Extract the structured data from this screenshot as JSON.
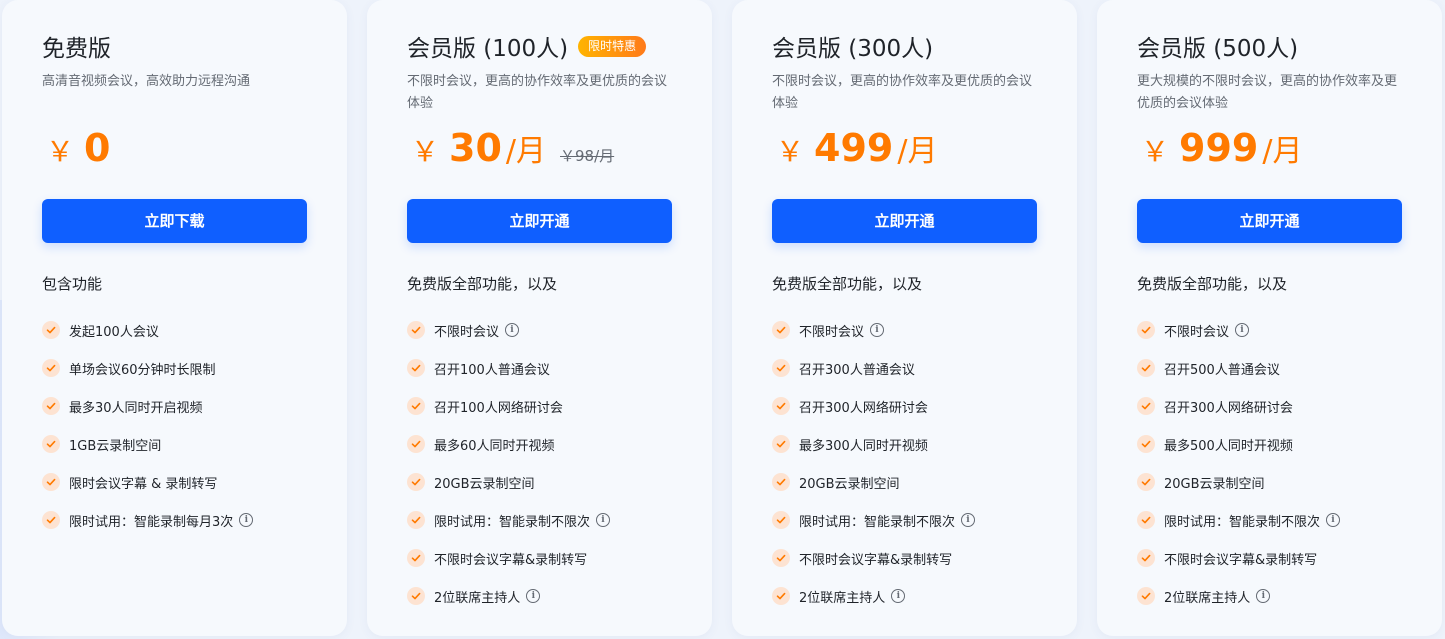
{
  "plans": [
    {
      "title": "免费版",
      "badge": "",
      "description": "高清音视频会议，高效助力远程沟通",
      "currency": "￥",
      "amount": "0",
      "unit": "",
      "original_price": "",
      "cta": "立即下载",
      "features_heading": "包含功能",
      "features": [
        {
          "text": "发起100人会议",
          "info": false
        },
        {
          "text": "单场会议60分钟时长限制",
          "info": false
        },
        {
          "text": "最多30人同时开启视频",
          "info": false
        },
        {
          "text": "1GB云录制空间",
          "info": false
        },
        {
          "text": "限时会议字幕 & 录制转写",
          "info": false
        },
        {
          "text": "限时试用：智能录制每月3次",
          "info": true
        }
      ]
    },
    {
      "title": "会员版 (100人)",
      "badge": "限时特惠",
      "description": "不限时会议，更高的协作效率及更优质的会议体验",
      "currency": "￥",
      "amount": "30",
      "unit": "/月",
      "original_price": "￥98/月",
      "cta": "立即开通",
      "features_heading": "免费版全部功能，以及",
      "features": [
        {
          "text": "不限时会议",
          "info": true
        },
        {
          "text": "召开100人普通会议",
          "info": false
        },
        {
          "text": "召开100人网络研讨会",
          "info": false
        },
        {
          "text": "最多60人同时开视频",
          "info": false
        },
        {
          "text": "20GB云录制空间",
          "info": false
        },
        {
          "text": "限时试用：智能录制不限次",
          "info": true
        },
        {
          "text": "不限时会议字幕&录制转写",
          "info": false
        },
        {
          "text": "2位联席主持人",
          "info": true
        }
      ]
    },
    {
      "title": "会员版 (300人)",
      "badge": "",
      "description": "不限时会议，更高的协作效率及更优质的会议体验",
      "currency": "￥",
      "amount": "499",
      "unit": "/月",
      "original_price": "",
      "cta": "立即开通",
      "features_heading": "免费版全部功能，以及",
      "features": [
        {
          "text": "不限时会议",
          "info": true
        },
        {
          "text": "召开300人普通会议",
          "info": false
        },
        {
          "text": "召开300人网络研讨会",
          "info": false
        },
        {
          "text": "最多300人同时开视频",
          "info": false
        },
        {
          "text": "20GB云录制空间",
          "info": false
        },
        {
          "text": "限时试用：智能录制不限次",
          "info": true
        },
        {
          "text": "不限时会议字幕&录制转写",
          "info": false
        },
        {
          "text": "2位联席主持人",
          "info": true
        }
      ]
    },
    {
      "title": "会员版 (500人)",
      "badge": "",
      "description": "更大规模的不限时会议，更高的协作效率及更优质的会议体验",
      "currency": "￥",
      "amount": "999",
      "unit": "/月",
      "original_price": "",
      "cta": "立即开通",
      "features_heading": "免费版全部功能，以及",
      "features": [
        {
          "text": "不限时会议",
          "info": true
        },
        {
          "text": "召开500人普通会议",
          "info": false
        },
        {
          "text": "召开300人网络研讨会",
          "info": false
        },
        {
          "text": "最多500人同时开视频",
          "info": false
        },
        {
          "text": "20GB云录制空间",
          "info": false
        },
        {
          "text": "限时试用：智能录制不限次",
          "info": true
        },
        {
          "text": "不限时会议字幕&录制转写",
          "info": false
        },
        {
          "text": "2位联席主持人",
          "info": true
        }
      ]
    }
  ],
  "icons": {
    "check": "check-icon",
    "info": "info-icon"
  },
  "colors": {
    "accent": "#0f5fff",
    "price": "#ff7a00",
    "check_bg": "#fde3d2",
    "badge_from": "#ffb400",
    "badge_to": "#ff7a1a"
  }
}
